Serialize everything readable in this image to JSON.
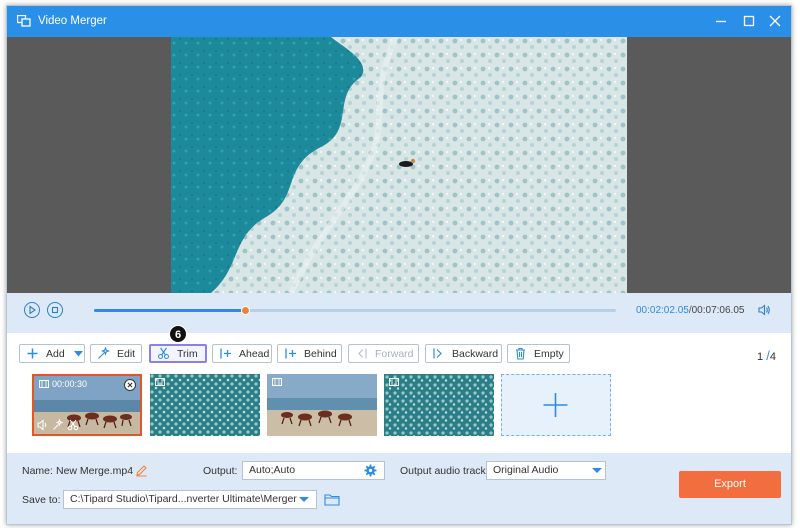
{
  "window": {
    "title": "Video Merger",
    "icon": "merger-app-icon"
  },
  "player": {
    "current_time": "00:02:02.05",
    "separator": "/",
    "total_time": "00:07:06.05",
    "progress": 0.29
  },
  "toolbar": {
    "add_label": "Add",
    "edit_label": "Edit",
    "trim_label": "Trim",
    "ahead_label": "Ahead",
    "behind_label": "Behind",
    "forward_label": "Forward",
    "backward_label": "Backward",
    "empty_label": "Empty",
    "step_badge": "6",
    "page_current": "1",
    "page_sep": "/",
    "page_total": "4"
  },
  "clips": [
    {
      "duration": "00:00:30",
      "content": "horses-running",
      "selected": true
    },
    {
      "duration": "",
      "content": "ocean-water",
      "selected": false
    },
    {
      "duration": "",
      "content": "horses-running",
      "selected": false
    },
    {
      "duration": "",
      "content": "ocean-water",
      "selected": false
    }
  ],
  "bottom": {
    "name_label": "Name:",
    "name_value": "New Merge.mp4",
    "output_label": "Output:",
    "output_value": "Auto;Auto",
    "audio_label": "Output audio track:",
    "audio_value": "Original Audio",
    "save_label": "Save to:",
    "save_path": "C:\\Tipard Studio\\Tipard...nverter Ultimate\\Merger",
    "export_label": "Export"
  },
  "colors": {
    "accent": "#2a8fe6",
    "export": "#f26e3f",
    "selected_clip": "#e2572a",
    "active_trim": "#8b7ff0"
  }
}
